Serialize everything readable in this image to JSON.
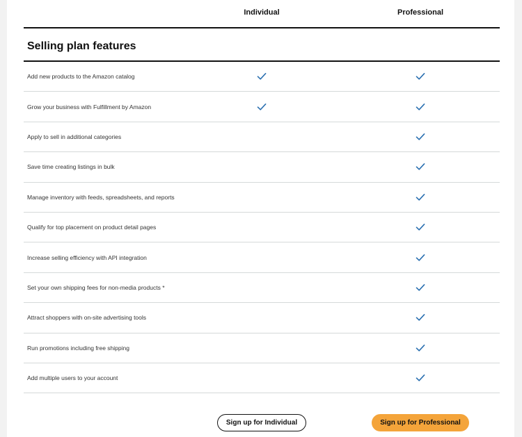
{
  "columns": {
    "individual": "Individual",
    "professional": "Professional"
  },
  "section_title": "Selling plan features",
  "features": [
    {
      "label": "Add new products to the Amazon catalog",
      "individual": true,
      "professional": true
    },
    {
      "label": "Grow your business with Fulfillment by Amazon",
      "individual": true,
      "professional": true
    },
    {
      "label": "Apply to sell in additional categories",
      "individual": false,
      "professional": true
    },
    {
      "label": "Save time creating listings in bulk",
      "individual": false,
      "professional": true
    },
    {
      "label": "Manage inventory with feeds, spreadsheets, and reports",
      "individual": false,
      "professional": true
    },
    {
      "label": "Qualify for top placement on product detail pages",
      "individual": false,
      "professional": true
    },
    {
      "label": "Increase selling efficiency with API integration",
      "individual": false,
      "professional": true
    },
    {
      "label": "Set your own shipping fees for non-media products *",
      "individual": false,
      "professional": true
    },
    {
      "label": "Attract shoppers with on-site advertising tools",
      "individual": false,
      "professional": true
    },
    {
      "label": "Run promotions including free shipping",
      "individual": false,
      "professional": true
    },
    {
      "label": "Add multiple users to your account",
      "individual": false,
      "professional": true
    }
  ],
  "buttons": {
    "individual": "Sign up for Individual",
    "professional": "Sign up for Professional"
  },
  "colors": {
    "check": "#2a6fb0",
    "primary_button": "#f4a43a",
    "divider": "#d5d9d9"
  },
  "icons": {
    "check": "checkmark-icon"
  }
}
